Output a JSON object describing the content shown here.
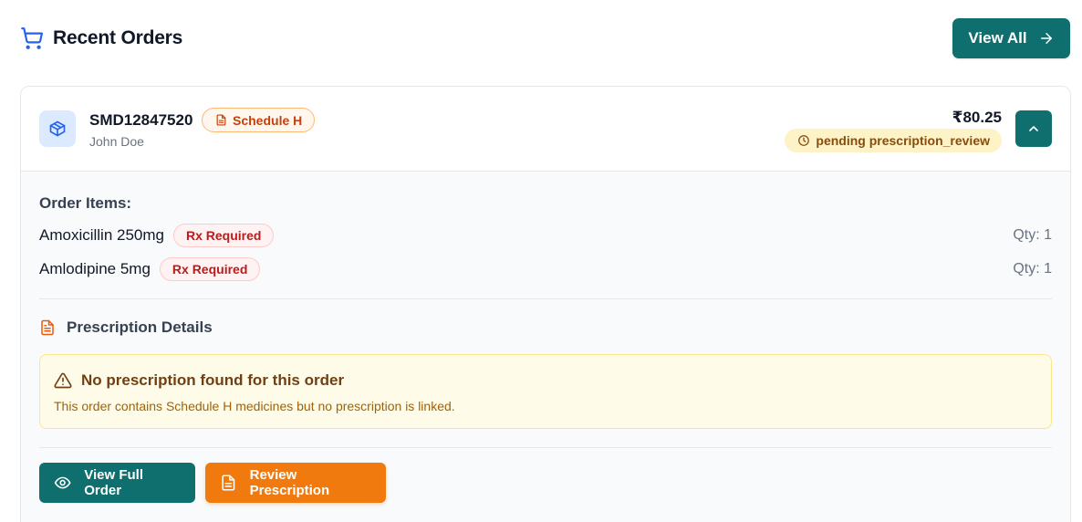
{
  "header": {
    "icon": "cart-icon",
    "title": "Recent Orders",
    "view_all_label": "View All"
  },
  "order": {
    "id": "SMD12847520",
    "schedule_badge": "Schedule H",
    "customer": "John Doe",
    "amount": "₹80.25",
    "status": "pending prescription_review",
    "items_title": "Order Items:",
    "items": [
      {
        "name": "Amoxicillin 250mg",
        "badge": "Rx Required",
        "qty": "Qty: 1"
      },
      {
        "name": "Amlodipine 5mg",
        "badge": "Rx Required",
        "qty": "Qty: 1"
      }
    ],
    "prescription_title": "Prescription Details",
    "warning_title": "No prescription found for this order",
    "warning_desc": "This order contains Schedule H medicines but no prescription is linked.",
    "actions": {
      "view_full_order": "View Full Order",
      "review_prescription": "Review Prescription"
    }
  },
  "colors": {
    "primary": "#0f6e6e",
    "orange": "#f07a0e",
    "warning_bg": "#fefce8",
    "rx_red": "#b91c1c"
  }
}
